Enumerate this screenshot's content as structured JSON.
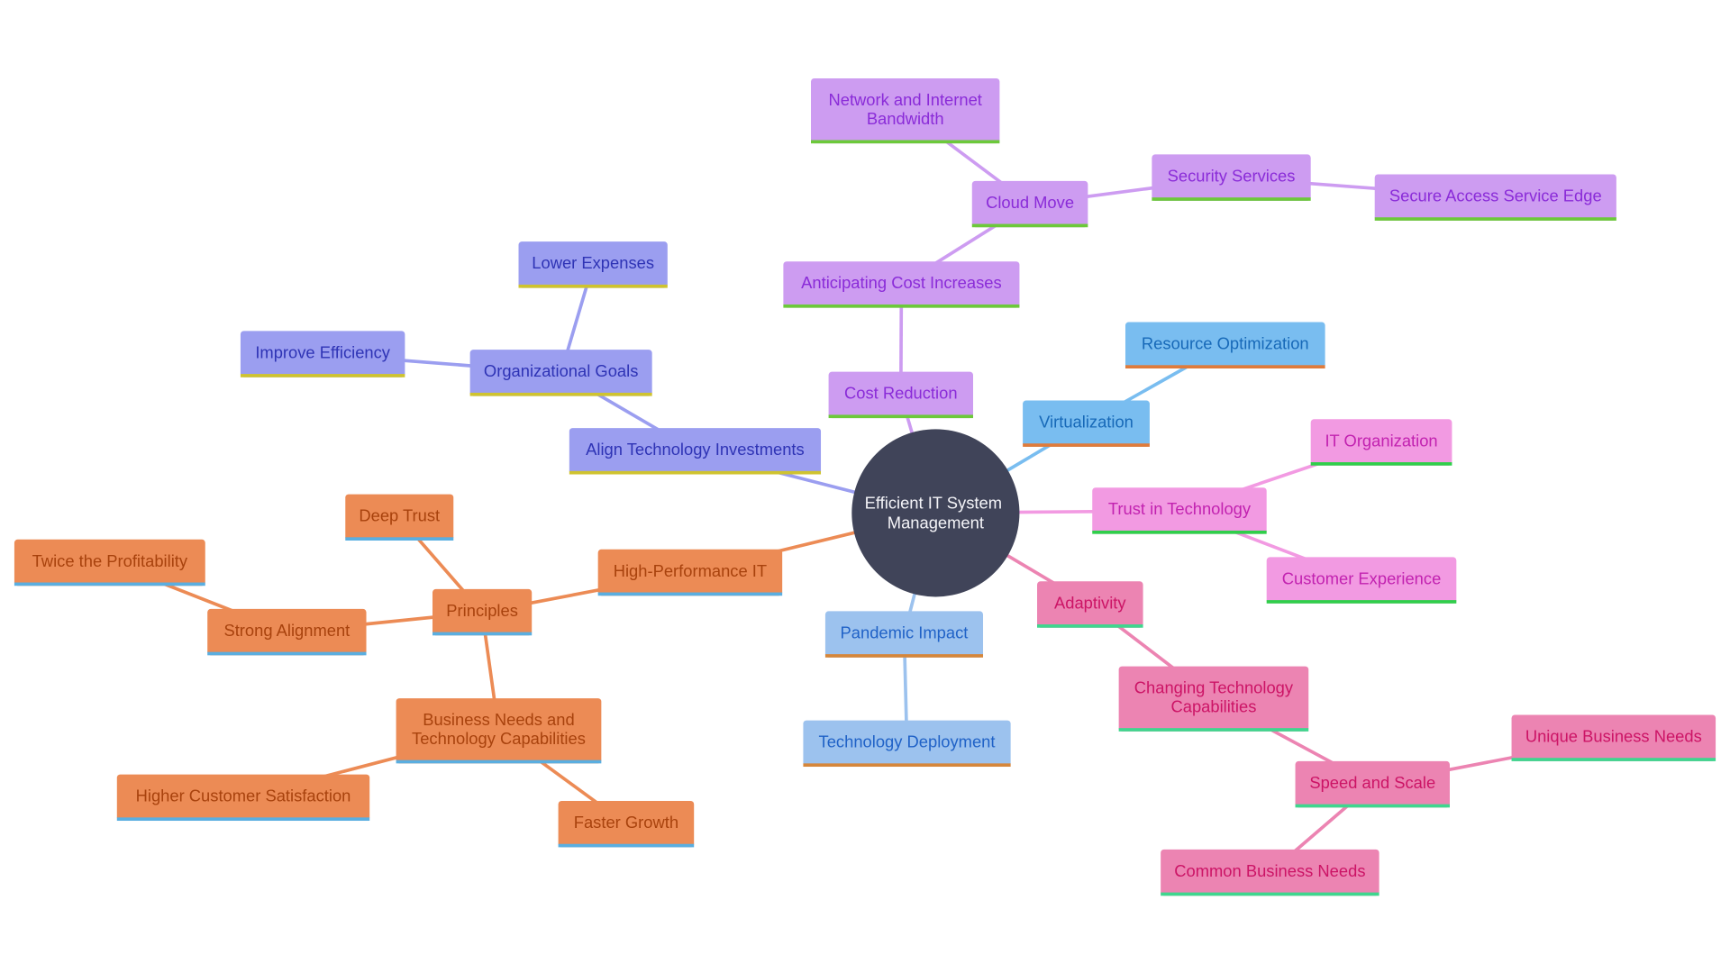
{
  "title": "Efficient IT System Management",
  "root": {
    "id": "root",
    "label_lines": [
      "Efficient IT System",
      "Management"
    ],
    "fill": "#404459"
  },
  "themes": {
    "purple": {
      "fill": "#cd9cf1",
      "text": "#8a2bd8",
      "bar": "#6cc93a",
      "edge": "#cd9cf1"
    },
    "indigo": {
      "fill": "#9b9ef0",
      "text": "#2e33b5",
      "bar": "#cfc32f",
      "edge": "#9b9ef0"
    },
    "orange": {
      "fill": "#ec8b55",
      "text": "#a8420d",
      "bar": "#5aaee0",
      "edge": "#ec8b55"
    },
    "skyblue": {
      "fill": "#79bdf0",
      "text": "#1769b8",
      "bar": "#e07b3a",
      "edge": "#79bdf0"
    },
    "lightblue": {
      "fill": "#9cc2ee",
      "text": "#2062c7",
      "bar": "#d5863a",
      "edge": "#9cc2ee"
    },
    "magenta": {
      "fill": "#f29ae2",
      "text": "#c222b0",
      "bar": "#2fcf4a",
      "edge": "#f29ae2"
    },
    "pink": {
      "fill": "#ec84b2",
      "text": "#cc1466",
      "bar": "#3fd68e",
      "edge": "#ec84b2"
    }
  },
  "nodes": [
    {
      "id": "cost-reduction",
      "label_lines": [
        "Cost Reduction"
      ],
      "theme": "purple",
      "parent": "root"
    },
    {
      "id": "anticipating-cost-increases",
      "label_lines": [
        "Anticipating Cost Increases"
      ],
      "theme": "purple",
      "parent": "cost-reduction"
    },
    {
      "id": "cloud-move",
      "label_lines": [
        "Cloud Move"
      ],
      "theme": "purple",
      "parent": "anticipating-cost-increases"
    },
    {
      "id": "network-bandwidth",
      "label_lines": [
        "Network and Internet",
        "Bandwidth"
      ],
      "theme": "purple",
      "parent": "cloud-move"
    },
    {
      "id": "security-services",
      "label_lines": [
        "Security Services"
      ],
      "theme": "purple",
      "parent": "cloud-move"
    },
    {
      "id": "sase",
      "label_lines": [
        "Secure Access Service Edge"
      ],
      "theme": "purple",
      "parent": "security-services"
    },
    {
      "id": "align-tech-investments",
      "label_lines": [
        "Align Technology Investments"
      ],
      "theme": "indigo",
      "parent": "root"
    },
    {
      "id": "organizational-goals",
      "label_lines": [
        "Organizational Goals"
      ],
      "theme": "indigo",
      "parent": "align-tech-investments"
    },
    {
      "id": "lower-expenses",
      "label_lines": [
        "Lower Expenses"
      ],
      "theme": "indigo",
      "parent": "organizational-goals"
    },
    {
      "id": "improve-efficiency",
      "label_lines": [
        "Improve Efficiency"
      ],
      "theme": "indigo",
      "parent": "organizational-goals"
    },
    {
      "id": "high-performance-it",
      "label_lines": [
        "High-Performance IT"
      ],
      "theme": "orange",
      "parent": "root"
    },
    {
      "id": "principles",
      "label_lines": [
        "Principles"
      ],
      "theme": "orange",
      "parent": "high-performance-it"
    },
    {
      "id": "deep-trust",
      "label_lines": [
        "Deep Trust"
      ],
      "theme": "orange",
      "parent": "principles"
    },
    {
      "id": "strong-alignment",
      "label_lines": [
        "Strong Alignment"
      ],
      "theme": "orange",
      "parent": "principles"
    },
    {
      "id": "twice-profitability",
      "label_lines": [
        "Twice the Profitability"
      ],
      "theme": "orange",
      "parent": "strong-alignment"
    },
    {
      "id": "business-needs-tech-capabilities",
      "label_lines": [
        "Business Needs and",
        "Technology Capabilities"
      ],
      "theme": "orange",
      "parent": "principles"
    },
    {
      "id": "higher-customer-satisfaction",
      "label_lines": [
        "Higher Customer Satisfaction"
      ],
      "theme": "orange",
      "parent": "business-needs-tech-capabilities"
    },
    {
      "id": "faster-growth",
      "label_lines": [
        "Faster Growth"
      ],
      "theme": "orange",
      "parent": "business-needs-tech-capabilities"
    },
    {
      "id": "virtualization",
      "label_lines": [
        "Virtualization"
      ],
      "theme": "skyblue",
      "parent": "root"
    },
    {
      "id": "resource-optimization",
      "label_lines": [
        "Resource Optimization"
      ],
      "theme": "skyblue",
      "parent": "virtualization"
    },
    {
      "id": "pandemic-impact",
      "label_lines": [
        "Pandemic Impact"
      ],
      "theme": "lightblue",
      "parent": "root"
    },
    {
      "id": "technology-deployment",
      "label_lines": [
        "Technology Deployment"
      ],
      "theme": "lightblue",
      "parent": "pandemic-impact"
    },
    {
      "id": "trust-in-technology",
      "label_lines": [
        "Trust in Technology"
      ],
      "theme": "magenta",
      "parent": "root"
    },
    {
      "id": "it-organization",
      "label_lines": [
        "IT Organization"
      ],
      "theme": "magenta",
      "parent": "trust-in-technology"
    },
    {
      "id": "customer-experience",
      "label_lines": [
        "Customer Experience"
      ],
      "theme": "magenta",
      "parent": "trust-in-technology"
    },
    {
      "id": "adaptivity",
      "label_lines": [
        "Adaptivity"
      ],
      "theme": "pink",
      "parent": "root"
    },
    {
      "id": "changing-tech-capabilities",
      "label_lines": [
        "Changing Technology",
        "Capabilities"
      ],
      "theme": "pink",
      "parent": "adaptivity"
    },
    {
      "id": "speed-and-scale",
      "label_lines": [
        "Speed and Scale"
      ],
      "theme": "pink",
      "parent": "changing-tech-capabilities"
    },
    {
      "id": "unique-business-needs",
      "label_lines": [
        "Unique Business Needs"
      ],
      "theme": "pink",
      "parent": "speed-and-scale"
    },
    {
      "id": "common-business-needs",
      "label_lines": [
        "Common Business Needs"
      ],
      "theme": "pink",
      "parent": "speed-and-scale"
    }
  ]
}
